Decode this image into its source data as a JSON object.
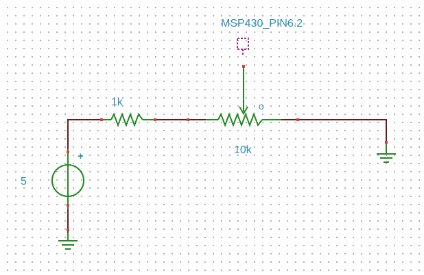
{
  "schematic": {
    "source": {
      "value_label": "5",
      "polarity_label": "+"
    },
    "resistor_fixed": {
      "value_label": "1k"
    },
    "potentiometer": {
      "value_label": "10k",
      "wiper_marker": "o"
    },
    "probe": {
      "net_label": "MSP430_PIN6.2"
    }
  },
  "colors": {
    "wire": "#6b1a1a",
    "component": "#1f8a1f",
    "pin_marker": "#e23a3a",
    "label": "#2e8fb6",
    "probe": "#b0259b",
    "grid_dot": "#9a9a9a"
  }
}
